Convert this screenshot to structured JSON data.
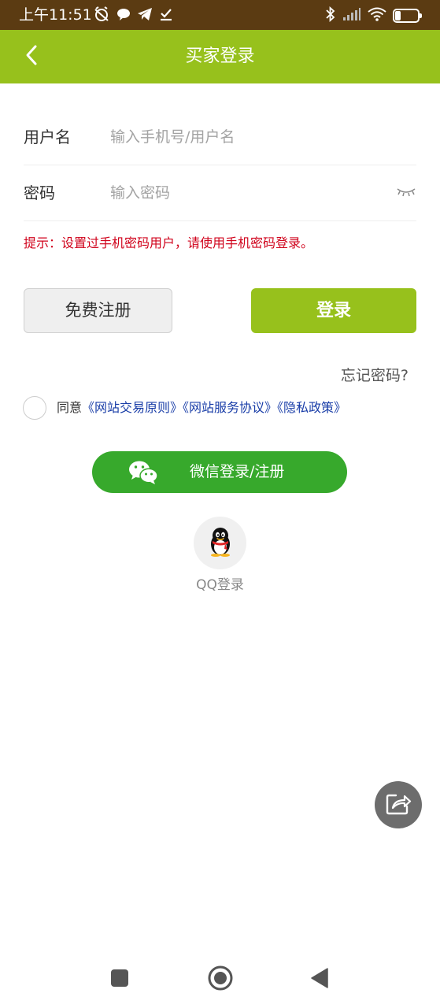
{
  "status_bar": {
    "time": "上午11:51",
    "battery_level": 25,
    "battery_text": "25"
  },
  "header": {
    "title": "买家登录",
    "back_icon": "chevron-left-icon"
  },
  "form": {
    "username": {
      "label": "用户名",
      "placeholder": "输入手机号/用户名",
      "value": ""
    },
    "password": {
      "label": "密码",
      "placeholder": "输入密码",
      "value": "",
      "toggle_icon": "eye-closed-icon"
    },
    "hint": "提示：设置过手机密码用户，请使用手机密码登录。"
  },
  "buttons": {
    "register": "免费注册",
    "login": "登录",
    "forgot": "忘记密码?"
  },
  "agreement": {
    "prefix": "同意",
    "links": [
      "《网站交易原则》",
      "《网站服务协议》",
      "《隐私政策》"
    ]
  },
  "social": {
    "wechat_label": "微信登录/注册",
    "qq_label": "QQ登录"
  },
  "colors": {
    "accent": "#97c11c",
    "status_bar": "#5b3b12",
    "wechat": "#37a92c",
    "hint": "#d0021b",
    "link": "#1a3ea8"
  }
}
